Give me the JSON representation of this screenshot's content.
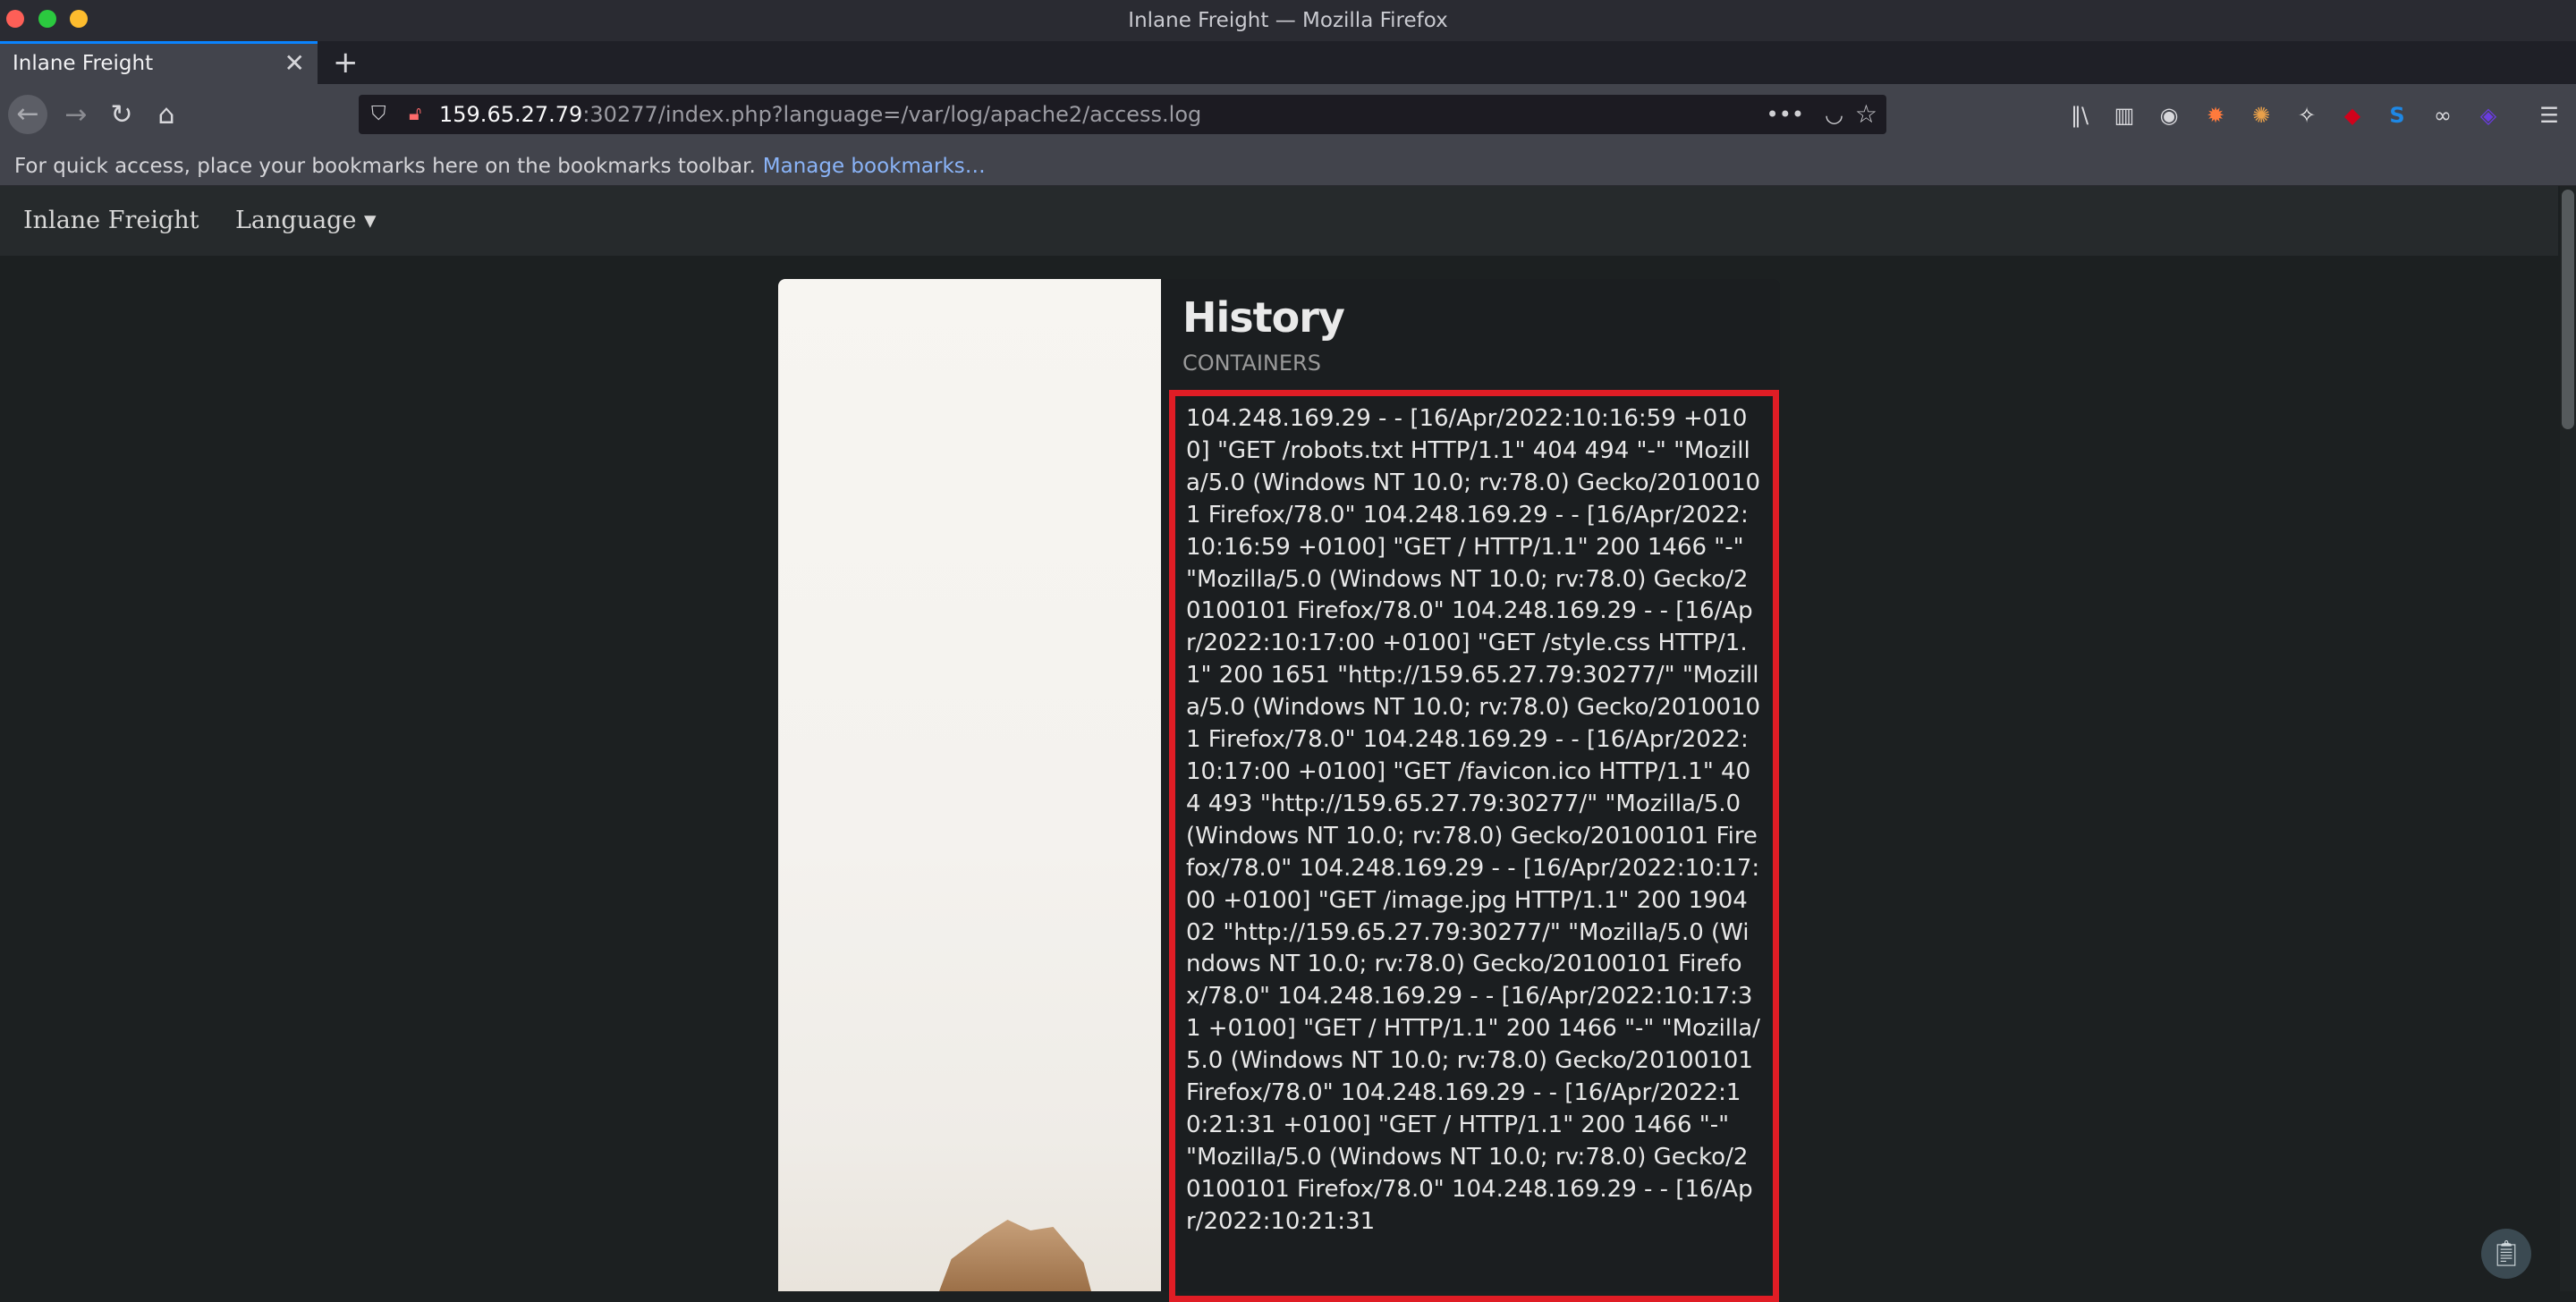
{
  "window": {
    "title": "Inlane Freight — Mozilla Firefox"
  },
  "tabs": [
    {
      "title": "Inlane Freight",
      "close_glyph": "✕"
    }
  ],
  "new_tab_glyph": "+",
  "navbar": {
    "back_glyph": "←",
    "forward_glyph": "→",
    "reload_glyph": "↻",
    "home_glyph": "⌂",
    "url_host": "159.65.27.79",
    "url_rest": ":30277/index.php?language=/var/log/apache2/access.log",
    "url_more_glyph": "•••",
    "toolbar_icons": [
      {
        "name": "library-icon",
        "glyph": "‖\\"
      },
      {
        "name": "sidebar-icon",
        "glyph": "▥"
      },
      {
        "name": "account-icon",
        "glyph": "◉"
      },
      {
        "name": "extension-foxyproxy-icon",
        "glyph": "✹"
      },
      {
        "name": "extension-cookie-icon",
        "glyph": "✺"
      },
      {
        "name": "extension-tiger-icon",
        "glyph": "✧"
      },
      {
        "name": "extension-ublock-icon",
        "glyph": "◆"
      },
      {
        "name": "extension-s-icon",
        "glyph": "S"
      },
      {
        "name": "extension-glasses-icon",
        "glyph": "∞"
      },
      {
        "name": "extension-purple-icon",
        "glyph": "◈"
      },
      {
        "name": "menu-icon",
        "glyph": "☰"
      }
    ]
  },
  "bookmarks_bar": {
    "text": "For quick access, place your bookmarks here on the bookmarks toolbar.",
    "link": "Manage bookmarks…"
  },
  "site": {
    "brand": "Inlane Freight",
    "language_menu": "Language ▾"
  },
  "card": {
    "title": "History",
    "subtitle": "CONTAINERS",
    "log": "104.248.169.29 - - [16/Apr/2022:10:16:59 +0100] \"GET /robots.txt HTTP/1.1\" 404 494 \"-\" \"Mozilla/5.0 (Windows NT 10.0; rv:78.0) Gecko/20100101 Firefox/78.0\" 104.248.169.29 - - [16/Apr/2022:10:16:59 +0100] \"GET / HTTP/1.1\" 200 1466 \"-\" \"Mozilla/5.0 (Windows NT 10.0; rv:78.0) Gecko/20100101 Firefox/78.0\" 104.248.169.29 - - [16/Apr/2022:10:17:00 +0100] \"GET /style.css HTTP/1.1\" 200 1651 \"http://159.65.27.79:30277/\" \"Mozilla/5.0 (Windows NT 10.0; rv:78.0) Gecko/20100101 Firefox/78.0\" 104.248.169.29 - - [16/Apr/2022:10:17:00 +0100] \"GET /favicon.ico HTTP/1.1\" 404 493 \"http://159.65.27.79:30277/\" \"Mozilla/5.0 (Windows NT 10.0; rv:78.0) Gecko/20100101 Firefox/78.0\" 104.248.169.29 - - [16/Apr/2022:10:17:00 +0100] \"GET /image.jpg HTTP/1.1\" 200 190402 \"http://159.65.27.79:30277/\" \"Mozilla/5.0 (Windows NT 10.0; rv:78.0) Gecko/20100101 Firefox/78.0\" 104.248.169.29 - - [16/Apr/2022:10:17:31 +0100] \"GET / HTTP/1.1\" 200 1466 \"-\" \"Mozilla/5.0 (Windows NT 10.0; rv:78.0) Gecko/20100101 Firefox/78.0\" 104.248.169.29 - - [16/Apr/2022:10:21:31 +0100] \"GET / HTTP/1.1\" 200 1466 \"-\" \"Mozilla/5.0 (Windows NT 10.0; rv:78.0) Gecko/20100101 Firefox/78.0\" 104.248.169.29 - - [16/Apr/2022:10:21:31"
  },
  "colors": {
    "highlight_border": "#e01d25",
    "tab_accent": "#0a84ff",
    "page_background": "#1c2021"
  }
}
